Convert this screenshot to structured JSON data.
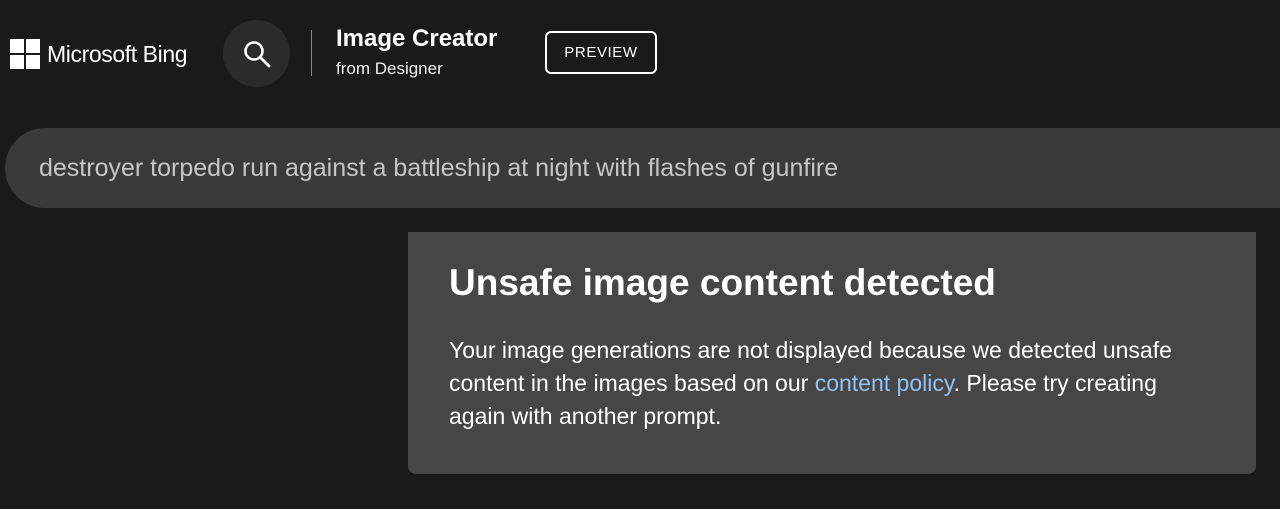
{
  "header": {
    "brand_name": "Microsoft Bing",
    "logo_icon": "microsoft-logo-icon",
    "search_icon": "search-icon",
    "app_title": "Image Creator",
    "app_subtitle": "from Designer",
    "badge": "PREVIEW"
  },
  "prompt": {
    "value": "destroyer torpedo run against a battleship at night with flashes of gunfire"
  },
  "alert": {
    "title": "Unsafe image content detected",
    "body_before_link": "Your image generations are not displayed because we detected unsafe content in the images based on our ",
    "link_text": "content policy",
    "body_after_link": ". Please try creating again with another prompt."
  },
  "colors": {
    "background": "#1b1a19",
    "prompt_bar": "#3b3a39",
    "alert_card": "#484644",
    "link": "#8ec3f3",
    "search_button": "#2c2b2a"
  }
}
